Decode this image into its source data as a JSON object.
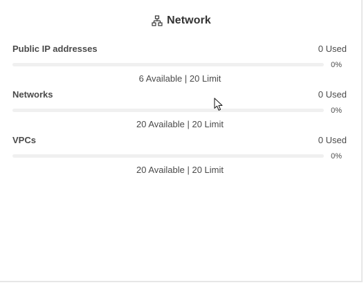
{
  "header": {
    "title": "Network",
    "icon": "network-topology-icon"
  },
  "quotas": [
    {
      "name": "Public IP addresses",
      "used": "0 Used",
      "percent": "0%",
      "used_fraction": 0,
      "available": "6 Available",
      "limit": "20 Limit",
      "separator": "|"
    },
    {
      "name": "Networks",
      "used": "0 Used",
      "percent": "0%",
      "used_fraction": 0,
      "available": "20 Available",
      "limit": "20 Limit",
      "separator": "|"
    },
    {
      "name": "VPCs",
      "used": "0 Used",
      "percent": "0%",
      "used_fraction": 0,
      "available": "20 Available",
      "limit": "20 Limit",
      "separator": "|"
    }
  ],
  "colors": {
    "text": "#333333",
    "bar_track": "#f0f0f0",
    "bar_fill": "#0f6cbd"
  },
  "cursor": {
    "icon": "mouse-pointer-icon"
  }
}
